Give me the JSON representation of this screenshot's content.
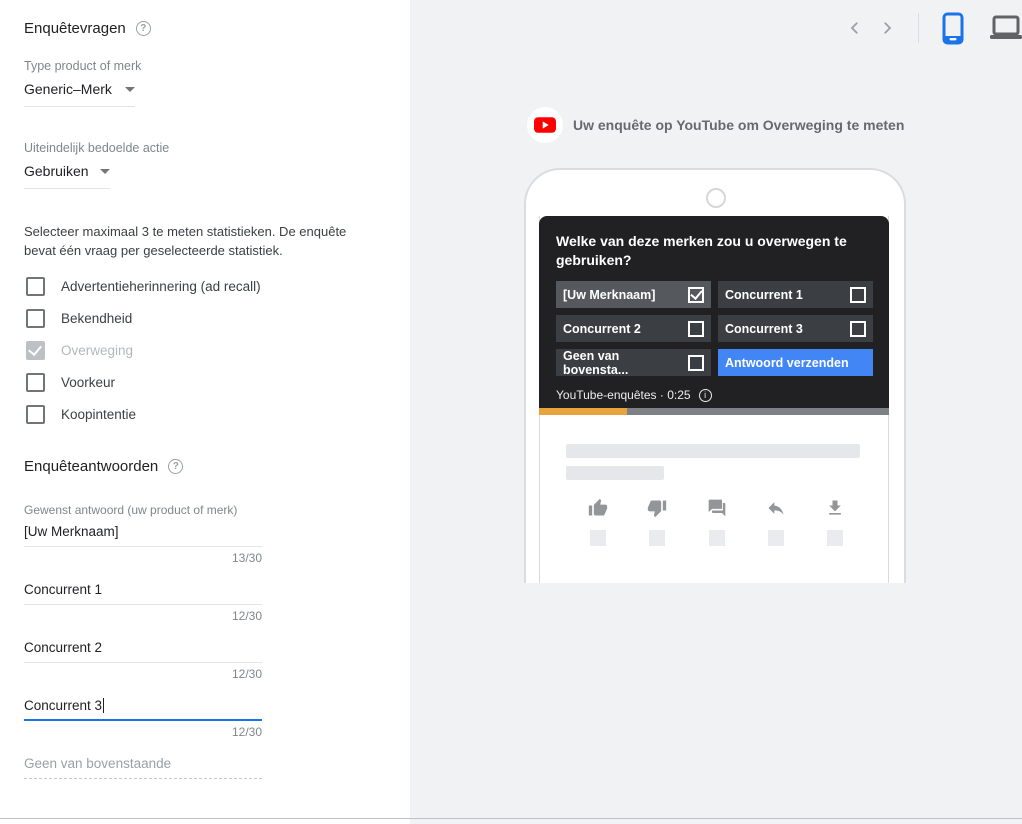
{
  "left_panel": {
    "title": "Enquêtevragen",
    "product_type": {
      "label": "Type product of merk",
      "value": "Generic–Merk"
    },
    "intended_action": {
      "label": "Uiteindelijk bedoelde actie",
      "value": "Gebruiken"
    },
    "metrics_instruction": "Selecteer maximaal 3 te meten statistieken. De enquête bevat één vraag per geselecteerde statistiek.",
    "metrics": [
      {
        "label": "Advertentieherinnering (ad recall)",
        "checked": false,
        "disabled": false
      },
      {
        "label": "Bekendheid",
        "checked": false,
        "disabled": false
      },
      {
        "label": "Overweging",
        "checked": true,
        "disabled": true
      },
      {
        "label": "Voorkeur",
        "checked": false,
        "disabled": false
      },
      {
        "label": "Koopintentie",
        "checked": false,
        "disabled": false
      }
    ],
    "answers_title": "Enquêteantwoorden",
    "answers": [
      {
        "label": "Gewenst antwoord (uw product of merk)",
        "value": "[Uw Merknaam]",
        "counter": "13/30",
        "state": "filled"
      },
      {
        "value": "Concurrent 1",
        "counter": "12/30",
        "state": "filled"
      },
      {
        "value": "Concurrent 2",
        "counter": "12/30",
        "state": "filled"
      },
      {
        "value": "Concurrent 3",
        "counter": "12/30",
        "state": "focused"
      },
      {
        "value": "Geen van bovenstaande",
        "state": "disabled"
      }
    ]
  },
  "preview": {
    "header": "Uw enquête op YouTube om Overweging te meten",
    "device_toggle": {
      "selected": "mobile",
      "options": [
        "mobile",
        "desktop"
      ]
    },
    "survey": {
      "question": "Welke van deze merken zou u overwegen te gebruiken?",
      "options": [
        {
          "label": "[Uw Merknaam]",
          "checked": true,
          "selected": true
        },
        {
          "label": "Concurrent 1",
          "checked": false
        },
        {
          "label": "Concurrent 2",
          "checked": false
        },
        {
          "label": "Concurrent 3",
          "checked": false
        },
        {
          "label": "Geen van bovensta...",
          "checked": false
        }
      ],
      "submit_label": "Antwoord verzenden",
      "attribution": "YouTube-enquêtes · 0:25",
      "info_glyph": "i",
      "progress_percent": 25
    },
    "colors": {
      "accent_blue": "#4285f4",
      "focus_blue": "#1a73e8",
      "progress_yellow": "#e8a33d",
      "youtube_red": "#ff0000",
      "card_dark": "#212124",
      "right_background": "#f1f2f4"
    }
  }
}
